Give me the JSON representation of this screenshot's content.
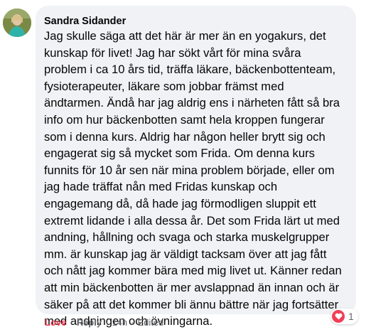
{
  "comment": {
    "author": "Sandra Sidander",
    "lines": [
      "Jag skulle säga att det här är mer än en yogakurs, det",
      "kunskap för livet! Jag har sökt vårt för mina svåra",
      "problem i ca 10 års tid, träffa läkare, bäckenbottenteam,",
      "fysioterapeuter, läkare som jobbar främst med",
      "ändtarmen. Ändå har jag aldrig ens i närheten fått så bra",
      "info om hur bäckenbotten samt hela kroppen fungerar",
      "som i denna kurs. Aldrig har någon heller brytt sig och",
      "engagerat sig så mycket som Frida. Om denna kurs",
      "funnits för 10 år sen när mina problem började, eller om",
      "jag hade träffat nån med Fridas kunskap och",
      "engagemang då, då hade jag förmodligen sluppit ett",
      "extremt lidande i alla dessa år. Det som Frida lärt ut med",
      "andning, hållning och svaga och starka muskelgrupper",
      "mm. är kunskap jag är väldigt tacksam över att jag fått",
      "och nått jag kommer bära med mig livet ut. Känner redan",
      "att min bäckenbotten är mer avslappnad än innan och är",
      "säker på att det kommer bli ännu bättre när jag fortsätter",
      "med andningen och övningarna."
    ],
    "reaction": {
      "icon": "heart-icon",
      "count": "1",
      "color": "#f33e58"
    }
  },
  "actions": {
    "love": "Love",
    "reply": "Reply",
    "separator": "·",
    "time": "14h",
    "edited": "Edited"
  }
}
